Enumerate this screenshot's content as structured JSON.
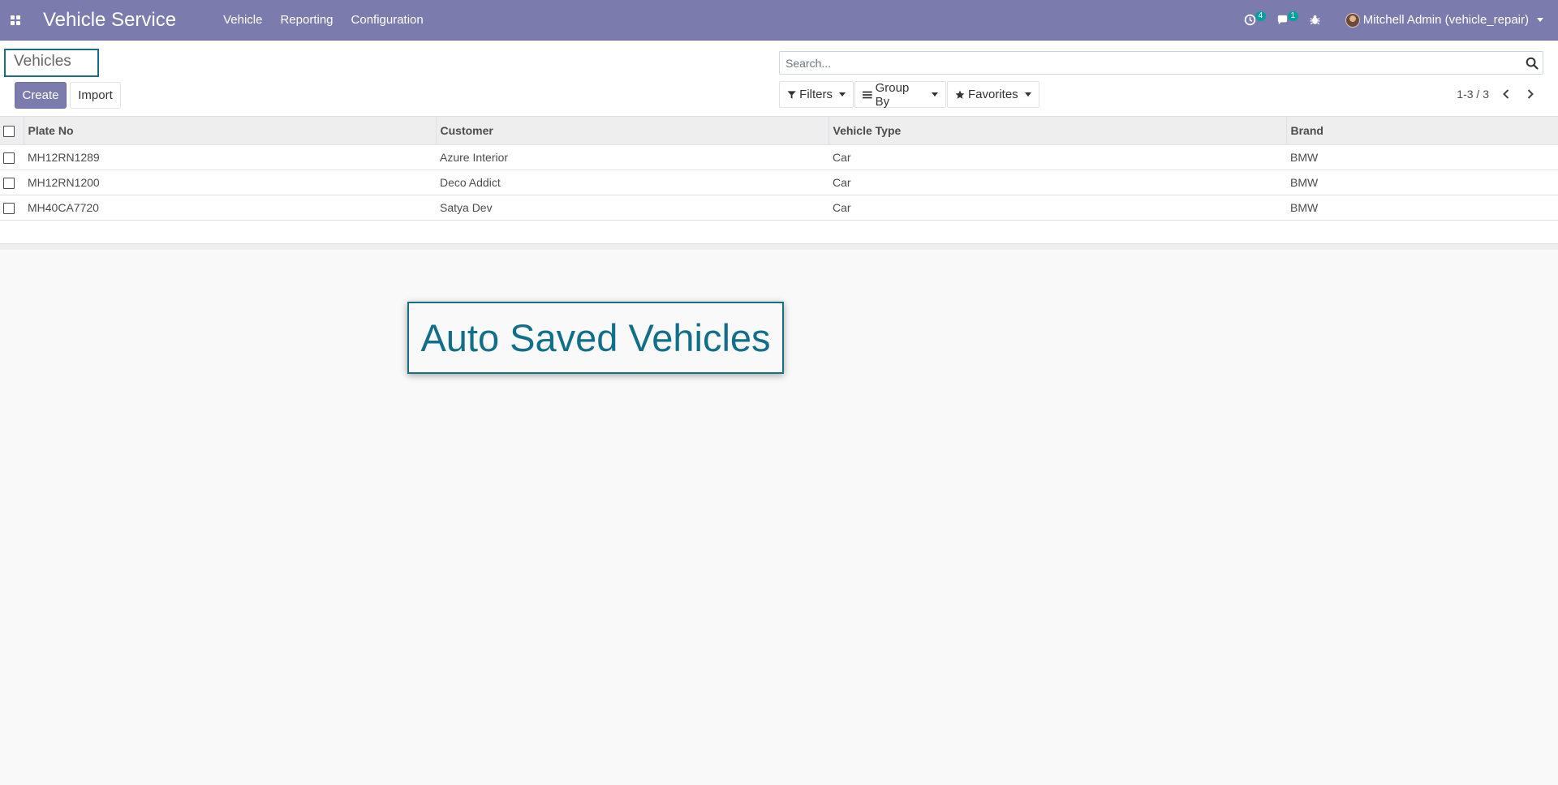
{
  "navbar": {
    "app_title": "Vehicle Service",
    "menu": [
      "Vehicle",
      "Reporting",
      "Configuration"
    ],
    "activity_count": "4",
    "message_count": "1",
    "user_name": "Mitchell Admin (vehicle_repair)"
  },
  "control_panel": {
    "breadcrumb": "Vehicles",
    "create_label": "Create",
    "import_label": "Import",
    "search_placeholder": "Search...",
    "filters_label": "Filters",
    "groupby_label": "Group By",
    "favorites_label": "Favorites",
    "pager": "1-3 / 3"
  },
  "table": {
    "columns": [
      "Plate No",
      "Customer",
      "Vehicle Type",
      "Brand"
    ],
    "rows": [
      {
        "plate": "MH12RN1289",
        "customer": "Azure Interior",
        "type": "Car",
        "brand": "BMW"
      },
      {
        "plate": "MH12RN1200",
        "customer": "Deco Addict",
        "type": "Car",
        "brand": "BMW"
      },
      {
        "plate": "MH40CA7720",
        "customer": "Satya Dev",
        "type": "Car",
        "brand": "BMW"
      }
    ]
  },
  "overlay": {
    "label": "Auto Saved Vehicles"
  },
  "colors": {
    "navbar": "#7c7bad",
    "accent": "#1a6e84",
    "badge": "#00a09d"
  }
}
